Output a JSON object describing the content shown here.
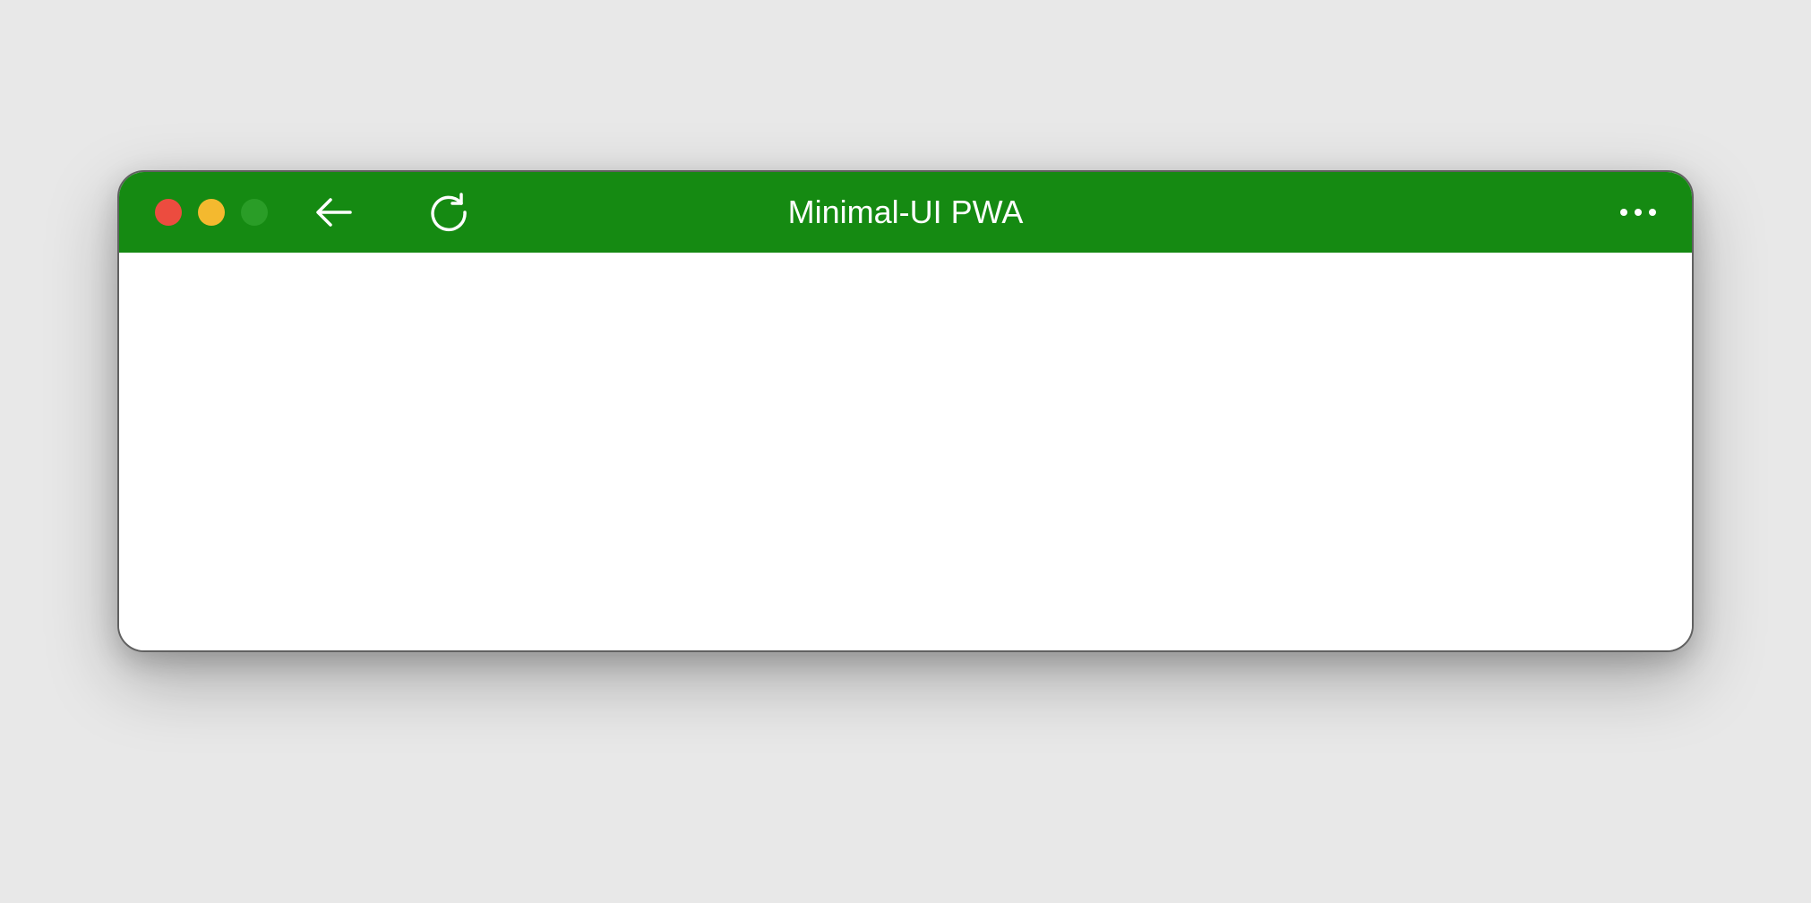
{
  "window": {
    "title": "Minimal-UI PWA"
  },
  "colors": {
    "titlebar": "#158a12",
    "trafficClose": "#ec4c3f",
    "trafficMinimize": "#f4b92f",
    "trafficMaximize": "#2a9d27"
  },
  "icons": {
    "back": "back-arrow-icon",
    "reload": "reload-icon",
    "more": "more-dots-icon"
  }
}
